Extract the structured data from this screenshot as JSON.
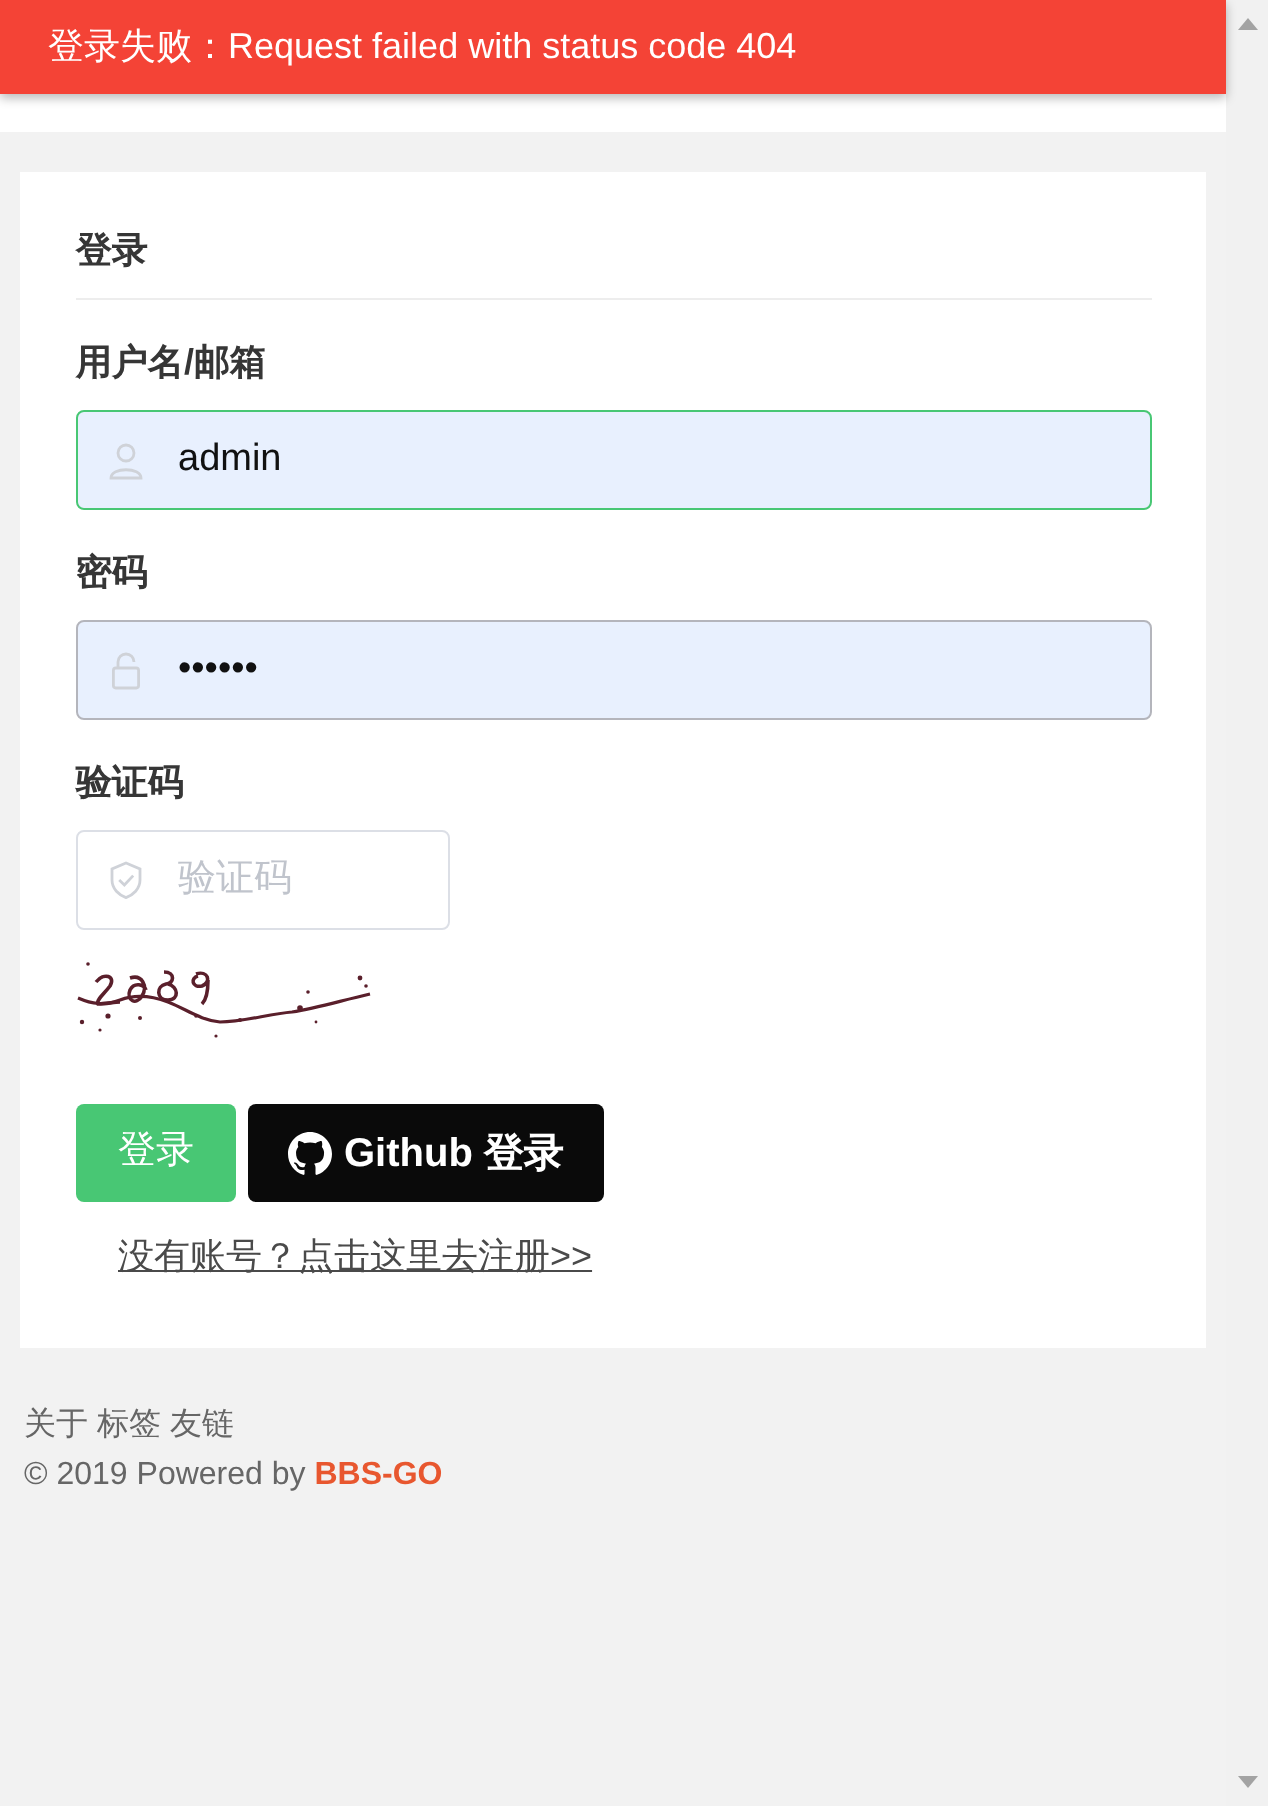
{
  "toast": {
    "message": "登录失败：Request failed with status code 404"
  },
  "login_form": {
    "title": "登录",
    "fields": [
      {
        "kind": "username",
        "label": "用户名/邮箱",
        "value": "admin",
        "focused": true,
        "autofilled": true
      },
      {
        "kind": "password",
        "label": "密码",
        "value": "••••••",
        "focused": false,
        "autofilled": true
      },
      {
        "kind": "captcha",
        "label": "验证码",
        "placeholder": "验证码",
        "focused": false,
        "autofilled": false
      }
    ],
    "buttons": [
      {
        "kind": "primary",
        "label": "登录"
      },
      {
        "kind": "github",
        "label": "Github 登录"
      }
    ],
    "register_link": "没有账号？点击这里去注册>>"
  },
  "footer": {
    "links": [
      "关于",
      "标签",
      "友链"
    ],
    "copyright": "© 2019 Powered by",
    "brand_link": "BBS-GO"
  }
}
